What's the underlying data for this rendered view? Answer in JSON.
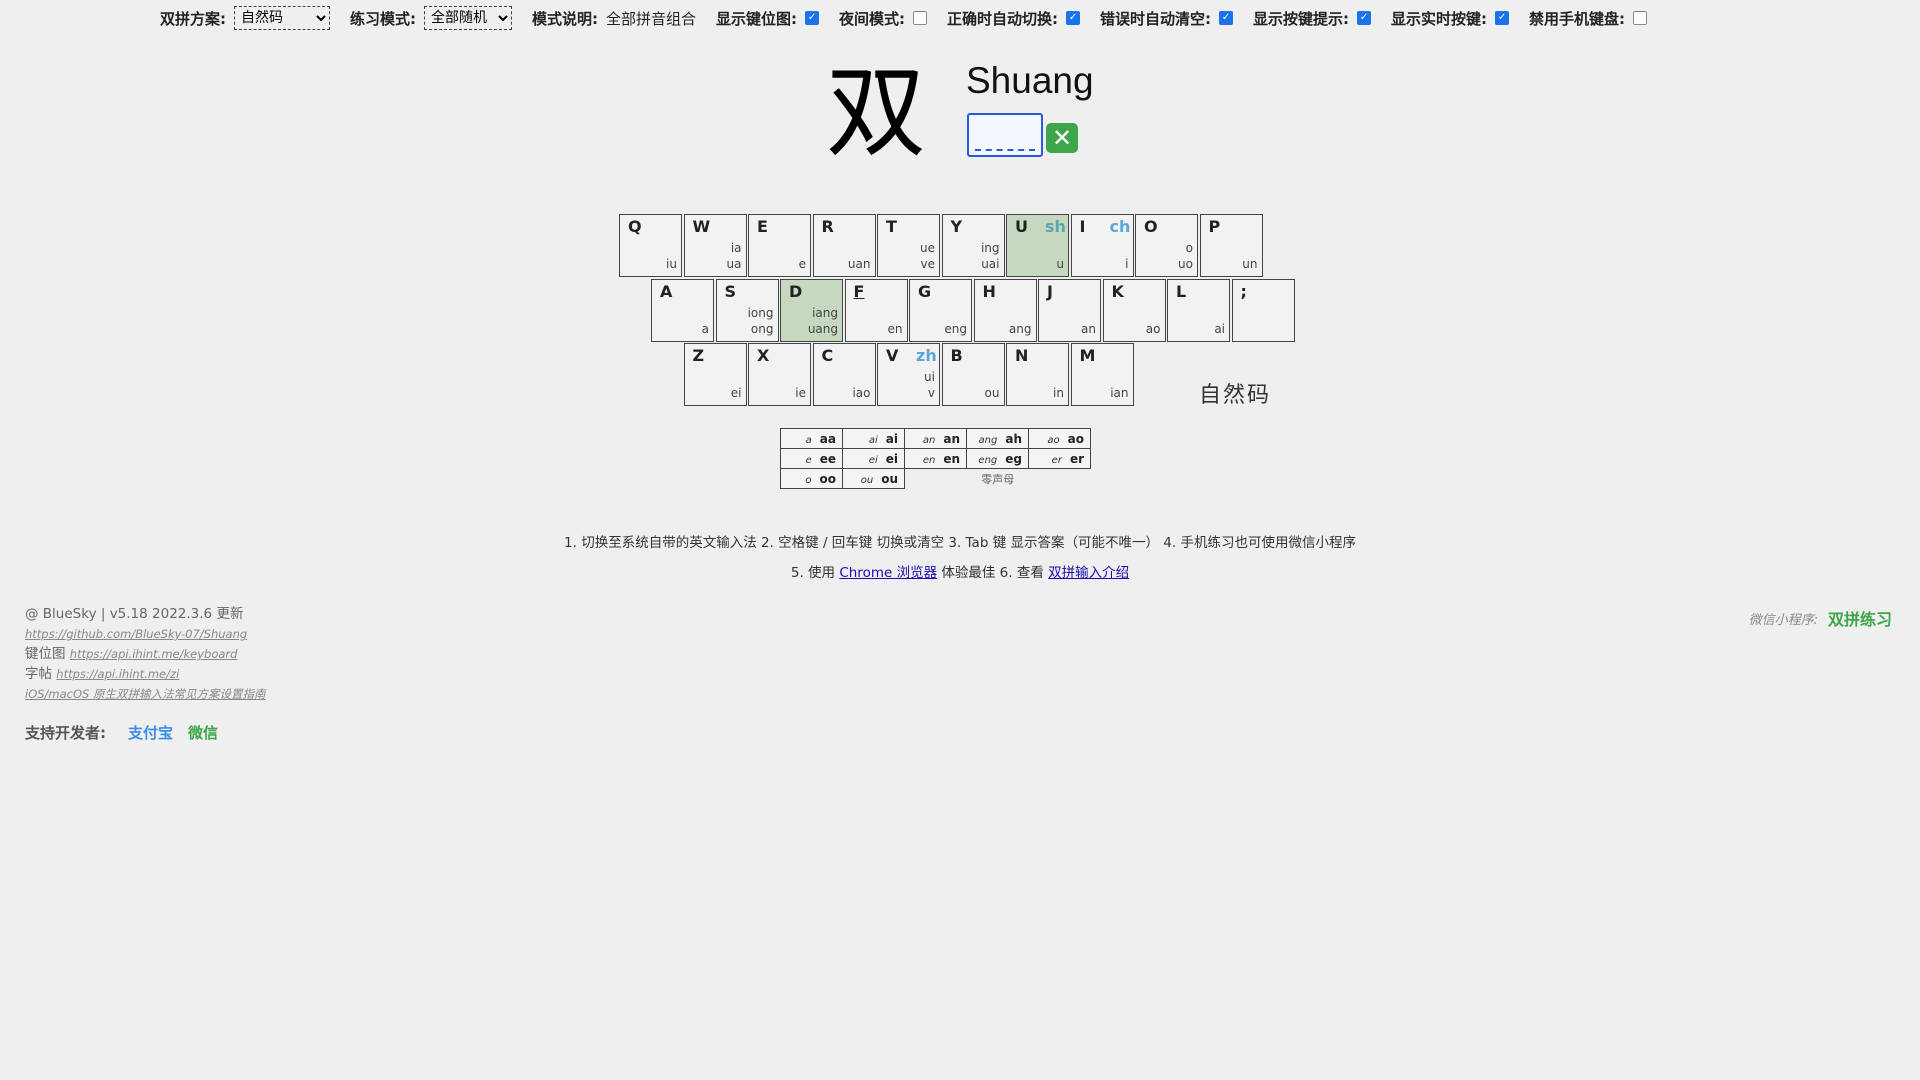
{
  "settings": {
    "scheme_label": "双拼方案:",
    "scheme_value": "自然码",
    "mode_label": "练习模式:",
    "mode_value": "全部随机",
    "desc_label": "模式说明:",
    "desc_value": "全部拼音组合",
    "show_layout_label": "显示键位图:",
    "night_label": "夜间模式:",
    "auto_switch_label": "正确时自动切换:",
    "auto_clear_label": "错误时自动清空:",
    "show_hint_label": "显示按键提示:",
    "show_realtime_label": "显示实时按键:",
    "disable_mobile_label": "禁用手机键盘:",
    "checks": {
      "show_layout": true,
      "night": false,
      "auto_switch": true,
      "auto_clear": true,
      "show_hint": true,
      "show_realtime": true,
      "disable_mobile": false
    }
  },
  "practice": {
    "hanzi": "双",
    "pinyin": "Shuang",
    "input_value": "",
    "clear_icon": "close-icon"
  },
  "keyboard": {
    "scheme_name": "自然码",
    "row1": [
      {
        "key": "Q",
        "finals": [
          "iu"
        ]
      },
      {
        "key": "W",
        "finals": [
          "ia",
          "ua"
        ]
      },
      {
        "key": "E",
        "finals": [
          "e"
        ]
      },
      {
        "key": "R",
        "finals": [
          "uan"
        ]
      },
      {
        "key": "T",
        "finals": [
          "ue",
          "ve"
        ]
      },
      {
        "key": "Y",
        "finals": [
          "ing",
          "uai"
        ]
      },
      {
        "key": "U",
        "initial": "sh",
        "finals": [
          "u"
        ],
        "highlight": true
      },
      {
        "key": "I",
        "initial": "ch",
        "finals": [
          "i"
        ]
      },
      {
        "key": "O",
        "finals": [
          "o",
          "uo"
        ]
      },
      {
        "key": "P",
        "finals": [
          "un"
        ]
      }
    ],
    "row2": [
      {
        "key": "A",
        "finals": [
          "a"
        ]
      },
      {
        "key": "S",
        "finals": [
          "iong",
          "ong"
        ]
      },
      {
        "key": "D",
        "finals": [
          "iang",
          "uang"
        ],
        "highlight": true
      },
      {
        "key": "F",
        "finals": [
          "en"
        ],
        "underline": true
      },
      {
        "key": "G",
        "finals": [
          "eng"
        ]
      },
      {
        "key": "H",
        "finals": [
          "ang"
        ]
      },
      {
        "key": "J",
        "finals": [
          "an"
        ],
        "underline": true
      },
      {
        "key": "K",
        "finals": [
          "ao"
        ]
      },
      {
        "key": "L",
        "finals": [
          "ai"
        ]
      },
      {
        "key": ";",
        "finals": []
      }
    ],
    "row3": [
      {
        "key": "Z",
        "finals": [
          "ei"
        ]
      },
      {
        "key": "X",
        "finals": [
          "ie"
        ]
      },
      {
        "key": "C",
        "finals": [
          "iao"
        ]
      },
      {
        "key": "V",
        "initial": "zh",
        "finals": [
          "ui",
          "v"
        ]
      },
      {
        "key": "B",
        "finals": [
          "ou"
        ]
      },
      {
        "key": "N",
        "finals": [
          "in"
        ]
      },
      {
        "key": "M",
        "finals": [
          "ian"
        ]
      }
    ],
    "zero_initial": {
      "rows": [
        [
          [
            "a",
            "aa"
          ],
          [
            "ai",
            "ai"
          ],
          [
            "an",
            "an"
          ],
          [
            "ang",
            "ah"
          ],
          [
            "ao",
            "ao"
          ]
        ],
        [
          [
            "e",
            "ee"
          ],
          [
            "ei",
            "ei"
          ],
          [
            "en",
            "en"
          ],
          [
            "eng",
            "eg"
          ],
          [
            "er",
            "er"
          ]
        ],
        [
          [
            "o",
            "oo"
          ],
          [
            "ou",
            "ou"
          ]
        ]
      ],
      "label": "零声母"
    }
  },
  "tips": {
    "line1": "1. 切换至系统自带的英文输入法  2. 空格键 / 回车键 切换或清空  3. Tab 键 显示答案（可能不唯一）  4. 手机练习也可使用微信小程序",
    "line2_pre": "5. 使用 ",
    "chrome_link": "Chrome 浏览器",
    "line2_mid": " 体验最佳  6. 查看 ",
    "intro_link": "双拼输入介绍"
  },
  "footer": {
    "version": "@ BlueSky | v5.18 2022.3.6 更新",
    "github": "https://github.com/BlueSky-07/Shuang",
    "layout_prefix": "键位图 ",
    "layout_link": "https://api.ihint.me/keyboard",
    "zi_prefix": "字帖 ",
    "zi_link": "https://api.ihint.me/zi",
    "ios_link": "iOS/macOS 原生双拼输入法常见方案设置指南",
    "support_label": "支持开发者:",
    "alipay": "支付宝",
    "wechat": "微信",
    "mini_label": "微信小程序:",
    "mini_name": "双拼练习"
  }
}
